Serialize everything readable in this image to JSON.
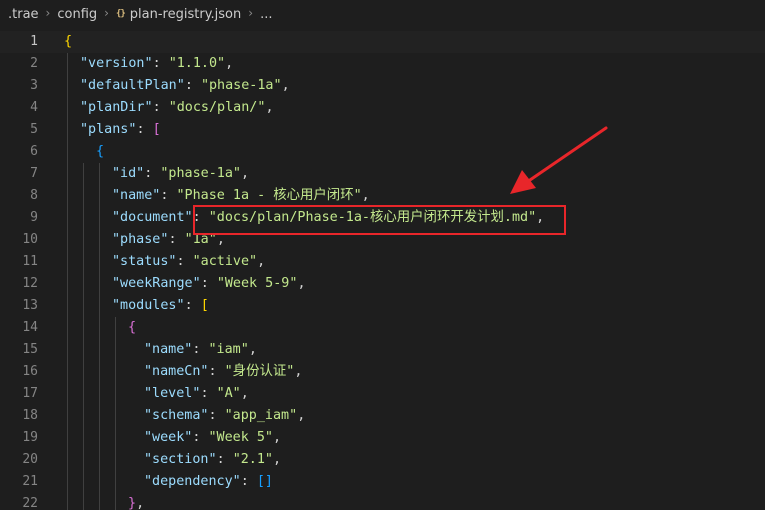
{
  "breadcrumb": {
    "items": [
      ".trae",
      "config",
      "plan-registry.json",
      "..."
    ],
    "file_icon": "{}"
  },
  "editor": {
    "current_line": 1,
    "lines": [
      {
        "n": "1",
        "tokens": [
          {
            "c": "b1",
            "t": "{"
          }
        ]
      },
      {
        "n": "2",
        "tokens": [
          {
            "c": "k",
            "t": "\"version\""
          },
          {
            "c": "p",
            "t": ": "
          },
          {
            "c": "s2",
            "t": "\"1.1.0\""
          },
          {
            "c": "p",
            "t": ","
          }
        ]
      },
      {
        "n": "3",
        "tokens": [
          {
            "c": "k",
            "t": "\"defaultPlan\""
          },
          {
            "c": "p",
            "t": ": "
          },
          {
            "c": "s2",
            "t": "\"phase-1a\""
          },
          {
            "c": "p",
            "t": ","
          }
        ]
      },
      {
        "n": "4",
        "tokens": [
          {
            "c": "k",
            "t": "\"planDir\""
          },
          {
            "c": "p",
            "t": ": "
          },
          {
            "c": "s2",
            "t": "\"docs/plan/\""
          },
          {
            "c": "p",
            "t": ","
          }
        ]
      },
      {
        "n": "5",
        "tokens": [
          {
            "c": "k",
            "t": "\"plans\""
          },
          {
            "c": "p",
            "t": ": "
          },
          {
            "c": "b2",
            "t": "["
          }
        ]
      },
      {
        "n": "6",
        "tokens": [
          {
            "c": "b3",
            "t": "{"
          }
        ]
      },
      {
        "n": "7",
        "tokens": [
          {
            "c": "k",
            "t": "\"id\""
          },
          {
            "c": "p",
            "t": ": "
          },
          {
            "c": "s2",
            "t": "\"phase-1a\""
          },
          {
            "c": "p",
            "t": ","
          }
        ]
      },
      {
        "n": "8",
        "tokens": [
          {
            "c": "k",
            "t": "\"name\""
          },
          {
            "c": "p",
            "t": ": "
          },
          {
            "c": "s2",
            "t": "\"Phase 1a - 核心用户闭环\""
          },
          {
            "c": "p",
            "t": ","
          }
        ]
      },
      {
        "n": "9",
        "tokens": [
          {
            "c": "k",
            "t": "\"document\""
          },
          {
            "c": "p",
            "t": ": "
          },
          {
            "c": "s2",
            "t": "\"docs/plan/Phase-1a-核心用户闭环开发计划.md\""
          },
          {
            "c": "p",
            "t": ","
          }
        ]
      },
      {
        "n": "10",
        "tokens": [
          {
            "c": "k",
            "t": "\"phase\""
          },
          {
            "c": "p",
            "t": ": "
          },
          {
            "c": "s2",
            "t": "\"1a\""
          },
          {
            "c": "p",
            "t": ","
          }
        ]
      },
      {
        "n": "11",
        "tokens": [
          {
            "c": "k",
            "t": "\"status\""
          },
          {
            "c": "p",
            "t": ": "
          },
          {
            "c": "s2",
            "t": "\"active\""
          },
          {
            "c": "p",
            "t": ","
          }
        ]
      },
      {
        "n": "12",
        "tokens": [
          {
            "c": "k",
            "t": "\"weekRange\""
          },
          {
            "c": "p",
            "t": ": "
          },
          {
            "c": "s2",
            "t": "\"Week 5-9\""
          },
          {
            "c": "p",
            "t": ","
          }
        ]
      },
      {
        "n": "13",
        "tokens": [
          {
            "c": "k",
            "t": "\"modules\""
          },
          {
            "c": "p",
            "t": ": "
          },
          {
            "c": "b1",
            "t": "["
          }
        ]
      },
      {
        "n": "14",
        "tokens": [
          {
            "c": "b2",
            "t": "{"
          }
        ]
      },
      {
        "n": "15",
        "tokens": [
          {
            "c": "k",
            "t": "\"name\""
          },
          {
            "c": "p",
            "t": ": "
          },
          {
            "c": "s2",
            "t": "\"iam\""
          },
          {
            "c": "p",
            "t": ","
          }
        ]
      },
      {
        "n": "16",
        "tokens": [
          {
            "c": "k",
            "t": "\"nameCn\""
          },
          {
            "c": "p",
            "t": ": "
          },
          {
            "c": "s2",
            "t": "\"身份认证\""
          },
          {
            "c": "p",
            "t": ","
          }
        ]
      },
      {
        "n": "17",
        "tokens": [
          {
            "c": "k",
            "t": "\"level\""
          },
          {
            "c": "p",
            "t": ": "
          },
          {
            "c": "s2",
            "t": "\"A\""
          },
          {
            "c": "p",
            "t": ","
          }
        ]
      },
      {
        "n": "18",
        "tokens": [
          {
            "c": "k",
            "t": "\"schema\""
          },
          {
            "c": "p",
            "t": ": "
          },
          {
            "c": "s2",
            "t": "\"app_iam\""
          },
          {
            "c": "p",
            "t": ","
          }
        ]
      },
      {
        "n": "19",
        "tokens": [
          {
            "c": "k",
            "t": "\"week\""
          },
          {
            "c": "p",
            "t": ": "
          },
          {
            "c": "s2",
            "t": "\"Week 5\""
          },
          {
            "c": "p",
            "t": ","
          }
        ]
      },
      {
        "n": "20",
        "tokens": [
          {
            "c": "k",
            "t": "\"section\""
          },
          {
            "c": "p",
            "t": ": "
          },
          {
            "c": "s2",
            "t": "\"2.1\""
          },
          {
            "c": "p",
            "t": ","
          }
        ]
      },
      {
        "n": "21",
        "tokens": [
          {
            "c": "k",
            "t": "\"dependency\""
          },
          {
            "c": "p",
            "t": ": "
          },
          {
            "c": "b3",
            "t": "[]"
          }
        ]
      },
      {
        "n": "22",
        "tokens": [
          {
            "c": "b2",
            "t": "}"
          },
          {
            "c": "p",
            "t": ","
          }
        ]
      }
    ]
  },
  "colors": {
    "background": "#1e1e1e",
    "key": "#9cdcfe",
    "string": "#c3e88d",
    "annotation": "#e8262a"
  },
  "annotation": {
    "icons": [
      "red-arrow-icon"
    ],
    "target_line": "9"
  }
}
